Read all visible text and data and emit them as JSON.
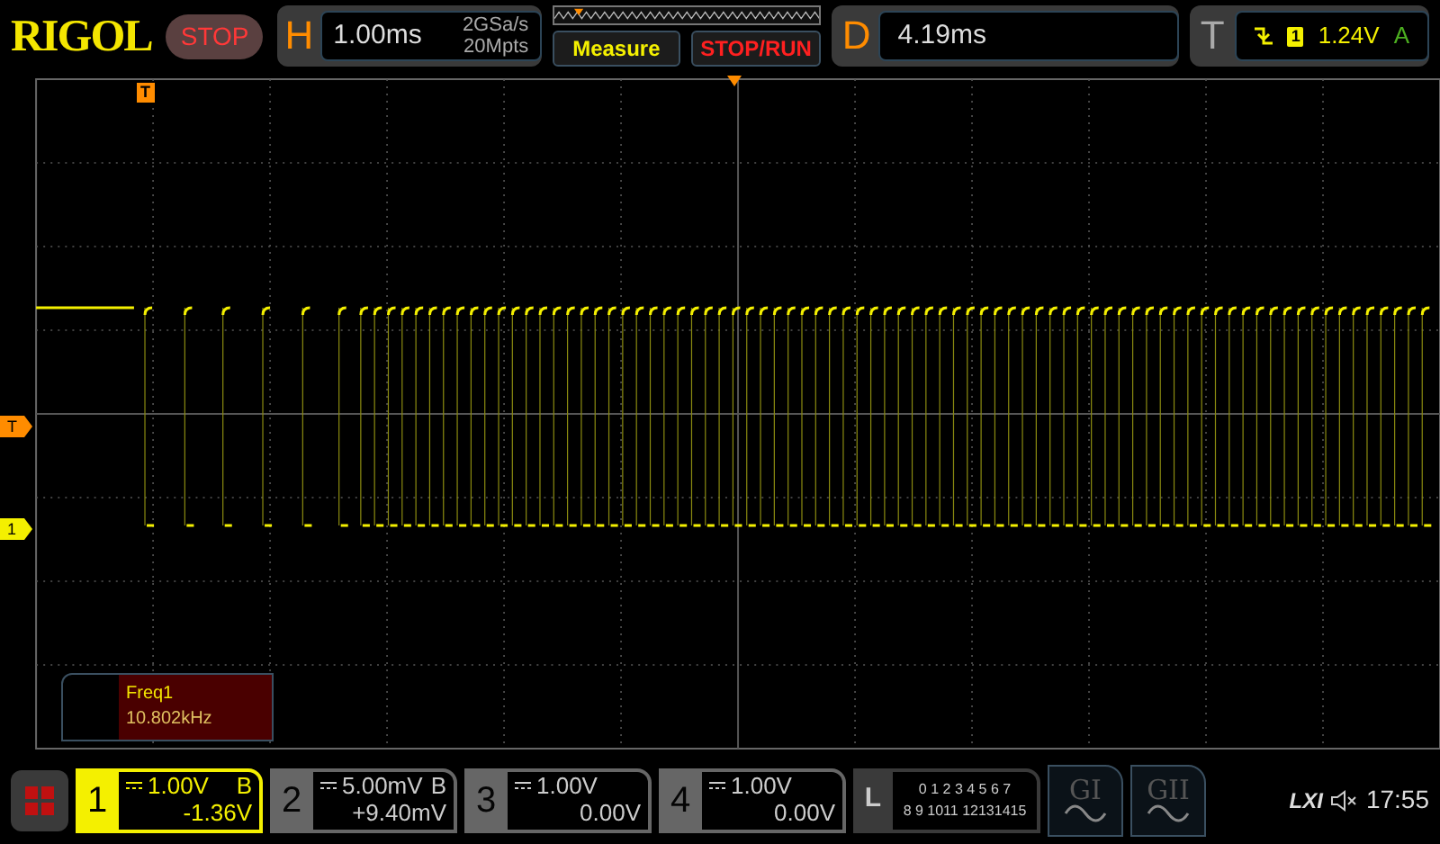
{
  "logo": "RIGOL",
  "run_state": "STOP",
  "horizontal": {
    "label": "H",
    "timebase": "1.00ms",
    "sample_rate": "2GSa/s",
    "memory_depth": "20Mpts"
  },
  "buttons": [
    {
      "label": "Measure",
      "kind": "measure"
    },
    {
      "label": "STOP/RUN",
      "kind": "run"
    }
  ],
  "delay": {
    "label": "D",
    "value": "4.19ms"
  },
  "trigger": {
    "label": "T",
    "source": "1",
    "level": "1.24V",
    "mode": "A"
  },
  "markers": {
    "trigger_position": "T",
    "trigger_level": "T",
    "channel": "1"
  },
  "measurement": {
    "title": "Freq1",
    "value": "10.802kHz"
  },
  "channels": [
    {
      "number": "1",
      "scale": "1.00V",
      "coupling": "B",
      "offset": "-1.36V",
      "selected": true
    },
    {
      "number": "2",
      "scale": "5.00mV",
      "coupling": "B",
      "offset": "+9.40mV",
      "selected": false
    },
    {
      "number": "3",
      "scale": "1.00V",
      "offset": "0.00V",
      "selected": false
    },
    {
      "number": "4",
      "scale": "1.00V",
      "offset": "0.00V",
      "selected": false
    }
  ],
  "logic": {
    "label": "L",
    "row_1": "0 1 2 3 4 5 6 7",
    "row_2": "8 9 1011 12131415"
  },
  "generators": [
    {
      "label": "GI"
    },
    {
      "label": "GII"
    }
  ],
  "status": {
    "lxi": "LXI",
    "time": "17:55"
  }
}
